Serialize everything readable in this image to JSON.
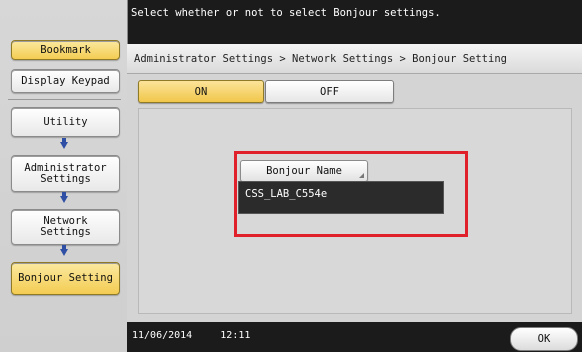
{
  "message": "Select whether or not to select Bonjour settings.",
  "sidebar": {
    "bookmark_label": "Bookmark",
    "display_keypad_label": "Display Keypad",
    "items": [
      {
        "label": "Utility"
      },
      {
        "label": "Administrator\nSettings"
      },
      {
        "label": "Network\nSettings"
      },
      {
        "label": "Bonjour Setting"
      }
    ]
  },
  "breadcrumb": "Administrator Settings > Network Settings > Bonjour Setting",
  "toggle": {
    "on_label": "ON",
    "off_label": "OFF",
    "selected": "ON"
  },
  "bonjour": {
    "name_button_label": "Bonjour Name",
    "name_value": "CSS_LAB_C554e"
  },
  "footer": {
    "date": "11/06/2014",
    "time": "12:11",
    "ok_label": "OK"
  },
  "colors": {
    "selected_yellow": "#f3cc52",
    "highlight_red": "#e0202a",
    "nav_arrow_blue": "#2e4fa4"
  }
}
